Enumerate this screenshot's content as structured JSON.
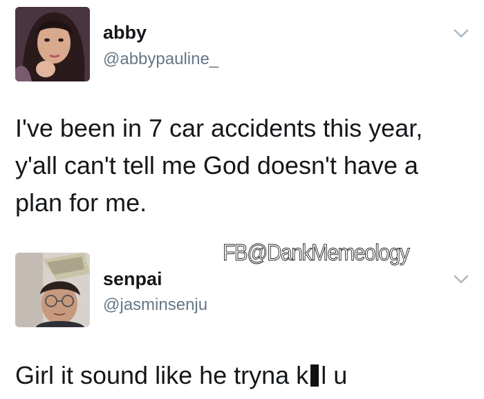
{
  "tweet": {
    "author_name": "abby",
    "author_handle": "@abbypauline_",
    "text": "I've been in 7 car accidents this year, y'all can't tell me God doesn't have a plan for me."
  },
  "reply": {
    "author_name": "senpai",
    "author_handle": "@jasminsenju",
    "text_before_censor": "Girl it sound like he tryna k",
    "text_after_censor": "l u"
  },
  "watermark": "FB@DankMemeology",
  "icons": {
    "tweet_menu": "chevron-down-icon",
    "reply_menu": "chevron-down-icon"
  },
  "colors": {
    "text": "#14171a",
    "handle": "#657786",
    "caret": "#aab8c2"
  }
}
